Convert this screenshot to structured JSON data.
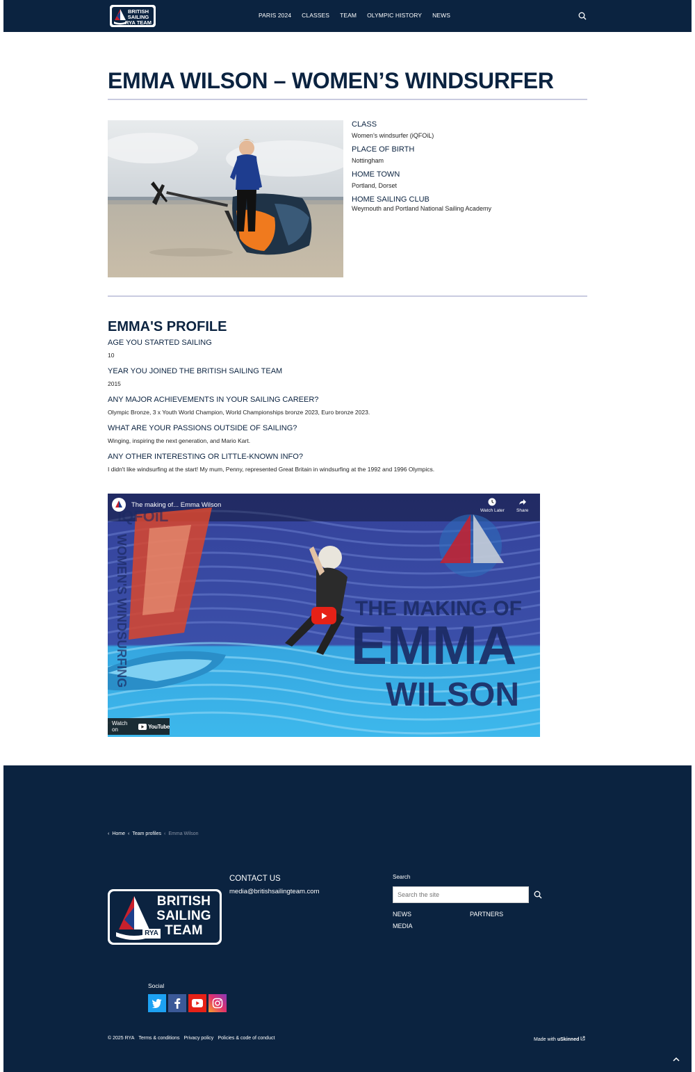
{
  "header": {
    "logo_lines": [
      "BRITISH",
      "SAILING",
      "RYA TEAM"
    ],
    "nav": [
      "PARIS 2024",
      "CLASSES",
      "TEAM",
      "OLYMPIC HISTORY",
      "NEWS"
    ]
  },
  "page": {
    "title": "EMMA WILSON – WOMEN’S WINDSURFER"
  },
  "facts": [
    {
      "label": "CLASS",
      "value": "Women’s windsurfer (iQFOiL)"
    },
    {
      "label": "PLACE OF BIRTH",
      "value": "Nottingham"
    },
    {
      "label": "HOME TOWN",
      "value": "Portland, Dorset"
    },
    {
      "label": "HOME SAILING CLUB",
      "value": "Weymouth and Portland National Sailing Academy"
    }
  ],
  "profile": {
    "title": "EMMA'S PROFILE",
    "items": [
      {
        "q": "AGE YOU STARTED SAILING",
        "a": "10"
      },
      {
        "q": "YEAR YOU JOINED THE BRITISH SAILING TEAM",
        "a": "2015"
      },
      {
        "q": "ANY MAJOR ACHIEVEMENTS IN YOUR SAILING CAREER?",
        "a": "Olympic Bronze, 3 x Youth World Champion, World Championships bronze 2023, Euro bronze 2023."
      },
      {
        "q": "WHAT ARE YOUR PASSIONS OUTSIDE OF SAILING?",
        "a": "Winging, inspiring the next generation, and Mario Kart."
      },
      {
        "q": "ANY OTHER INTERESTING OR LITTLE-KNOWN INFO?",
        "a": "I didn't like windsurfing at the start! My mum, Penny, represented Great Britain in windsurfing at the 1992 and 1996 Olympics."
      }
    ]
  },
  "video": {
    "title": "The making of... Emma Wilson",
    "watch_later": "Watch Later",
    "share": "Share",
    "watch_on": "Watch on",
    "youtube": "YouTube",
    "overlay_top": "THE MAKING OF",
    "overlay_mid": "EMMA",
    "overlay_bot": "WILSON",
    "side_text": "WOMEN'S WINDSURFING",
    "corner_text": "iQFOiL"
  },
  "footer": {
    "breadcrumb": [
      "Home",
      "Team profiles",
      "Emma Wilson"
    ],
    "logo_lines": [
      "BRITISH",
      "SAILING",
      "TEAM"
    ],
    "logo_badge": "RYA",
    "contact_title": "CONTACT US",
    "contact_email": "media@britishsailingteam.com",
    "search_label": "Search",
    "search_placeholder": "Search the site",
    "links": [
      "NEWS",
      "PARTNERS",
      "MEDIA"
    ],
    "social_label": "Social",
    "social": [
      "twitter-icon",
      "facebook-icon",
      "youtube-icon",
      "instagram-icon"
    ],
    "legal": [
      "© 2025 RYA",
      "Terms & conditions",
      "Privacy policy",
      "Policies & code of conduct"
    ],
    "made_with": "Made with",
    "made_brand": "uSkinned"
  },
  "colors": {
    "navy": "#0b2340",
    "rule": "#c9cbe0",
    "red": "#c8202c"
  }
}
